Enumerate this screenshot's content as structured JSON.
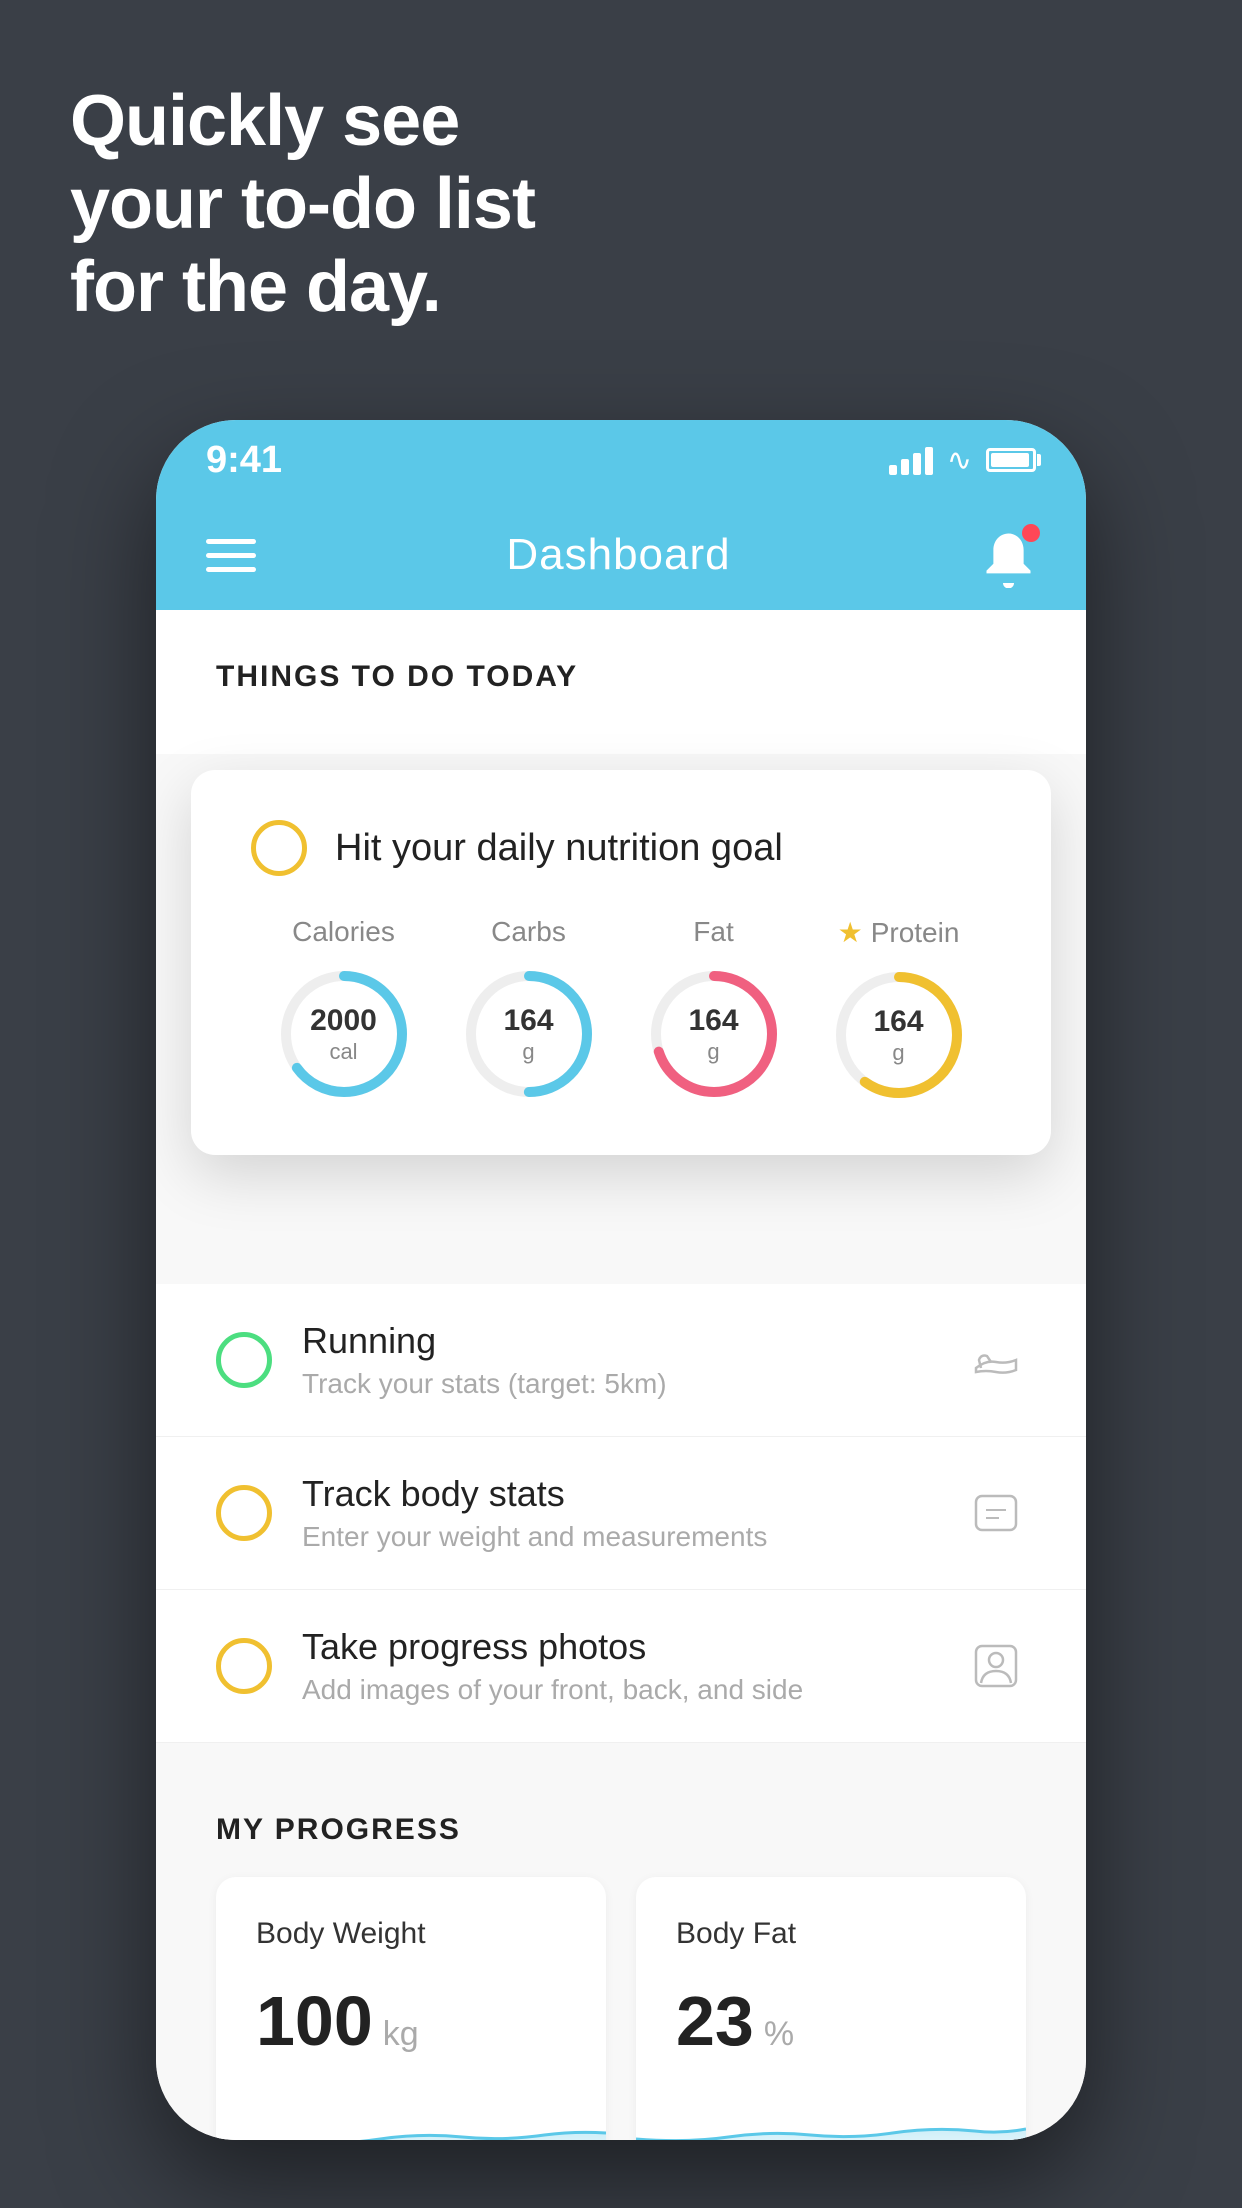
{
  "hero": {
    "line1": "Quickly see",
    "line2": "your to-do list",
    "line3": "for the day."
  },
  "status_bar": {
    "time": "9:41"
  },
  "header": {
    "title": "Dashboard"
  },
  "things_section": {
    "title": "THINGS TO DO TODAY"
  },
  "nutrition_card": {
    "title": "Hit your daily nutrition goal",
    "items": [
      {
        "label": "Calories",
        "value": "2000",
        "unit": "cal",
        "type": "blue",
        "progress": 0.65
      },
      {
        "label": "Carbs",
        "value": "164",
        "unit": "g",
        "type": "blue",
        "progress": 0.5
      },
      {
        "label": "Fat",
        "value": "164",
        "unit": "g",
        "type": "pink",
        "progress": 0.7
      },
      {
        "label": "Protein",
        "value": "164",
        "unit": "g",
        "type": "gold",
        "progress": 0.6,
        "starred": true
      }
    ]
  },
  "todo_items": [
    {
      "title": "Running",
      "subtitle": "Track your stats (target: 5km)",
      "completed": true,
      "icon": "shoe"
    },
    {
      "title": "Track body stats",
      "subtitle": "Enter your weight and measurements",
      "completed": false,
      "icon": "scale"
    },
    {
      "title": "Take progress photos",
      "subtitle": "Add images of your front, back, and side",
      "completed": false,
      "icon": "person"
    }
  ],
  "progress_section": {
    "title": "MY PROGRESS",
    "cards": [
      {
        "title": "Body Weight",
        "value": "100",
        "unit": "kg"
      },
      {
        "title": "Body Fat",
        "value": "23",
        "unit": "%"
      }
    ]
  }
}
